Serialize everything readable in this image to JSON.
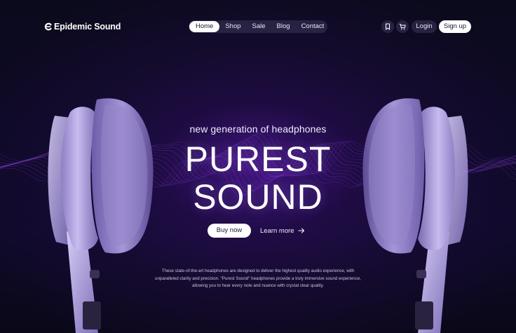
{
  "brand": {
    "name": "Epidemic Sound",
    "icon": "e-logo-icon"
  },
  "nav": {
    "items": [
      {
        "label": "Home",
        "active": true
      },
      {
        "label": "Shop",
        "active": false
      },
      {
        "label": "Sale",
        "active": false
      },
      {
        "label": "Blog",
        "active": false
      },
      {
        "label": "Contact",
        "active": false
      }
    ]
  },
  "actions": {
    "bookmark_icon": "bookmark-icon",
    "cart_icon": "cart-icon",
    "login_label": "Login",
    "signup_label": "Sign up"
  },
  "hero": {
    "tagline": "new generation of headphones",
    "headline_line1": "PUREST",
    "headline_line2": "SOUND",
    "buy_label": "Buy now",
    "learn_label": "Learn more",
    "learn_icon": "arrow-right-icon",
    "description": "These state-of-the-art headphones are designed to deliver the highest quality audio experience, with unparalleled clarity and precision. \"Purest Sound\" headphones provide a truly immersive sound experience, allowing you to hear every note and nuance with crystal clear quality."
  },
  "colors": {
    "background": "#0a0818",
    "glow": "#5a1eaa",
    "wave": "#a24bff",
    "headphone": "#b9a9e6",
    "button_bg": "#ffffff",
    "button_text": "#1b1630"
  }
}
